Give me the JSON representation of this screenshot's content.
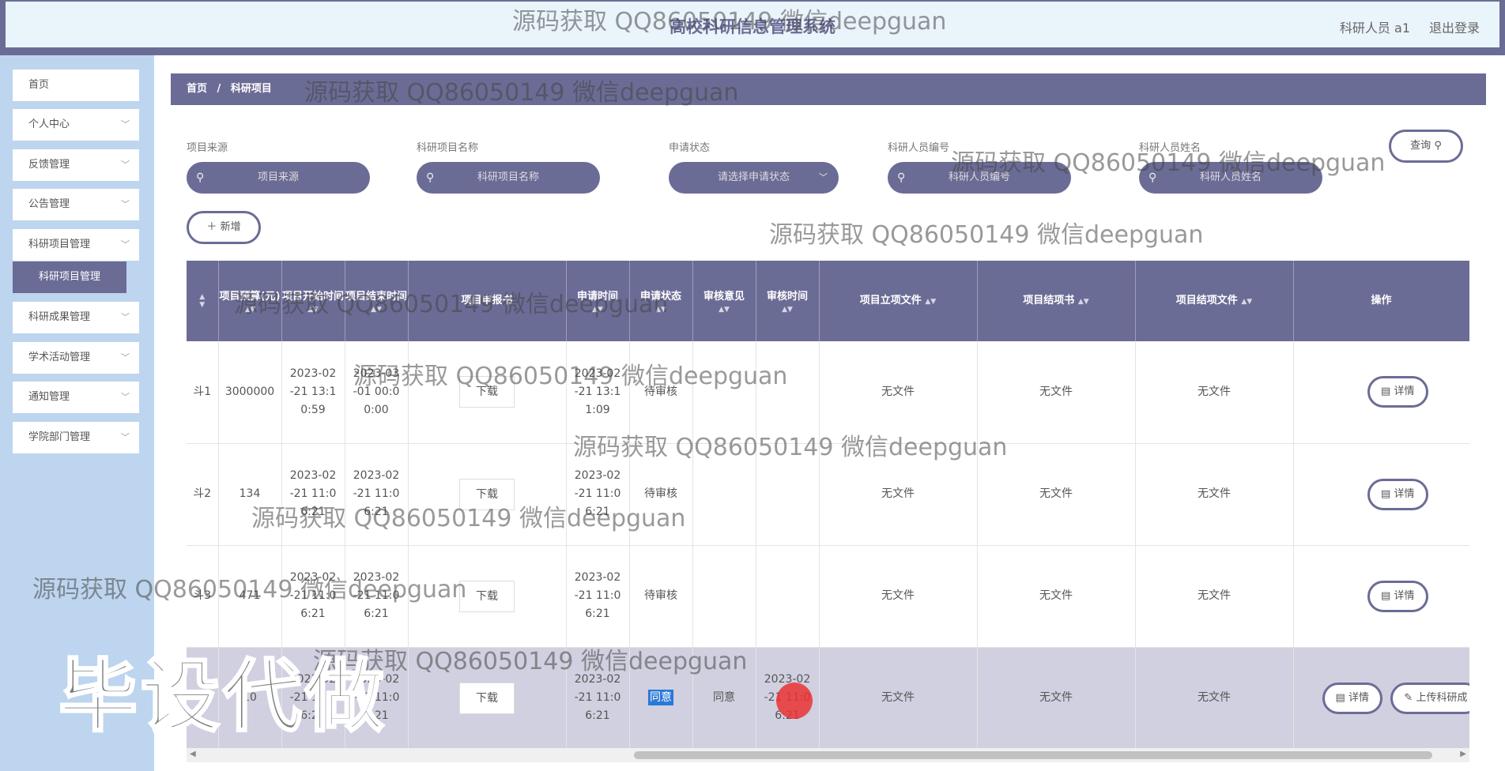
{
  "header": {
    "title": "高校科研信息管理系统",
    "user": "科研人员 a1",
    "logout": "退出登录"
  },
  "sidebar": {
    "items": [
      {
        "label": "首页",
        "has_chevron": false
      },
      {
        "label": "个人中心",
        "has_chevron": true
      },
      {
        "label": "反馈管理",
        "has_chevron": true
      },
      {
        "label": "公告管理",
        "has_chevron": true
      },
      {
        "label": "科研项目管理",
        "has_chevron": true
      },
      {
        "label": "科研成果管理",
        "has_chevron": true
      },
      {
        "label": "学术活动管理",
        "has_chevron": true
      },
      {
        "label": "通知管理",
        "has_chevron": true
      },
      {
        "label": "学院部门管理",
        "has_chevron": true
      }
    ],
    "active_sub": "科研项目管理"
  },
  "breadcrumb": {
    "home": "首页",
    "sep": "/",
    "current": "科研项目"
  },
  "filters": {
    "source_label": "项目来源",
    "source_placeholder": "项目来源",
    "name_label": "科研项目名称",
    "name_placeholder": "科研项目名称",
    "status_label": "申请状态",
    "status_placeholder": "请选择申请状态",
    "researcher_no_label": "科研人员编号",
    "researcher_no_placeholder": "科研人员编号",
    "researcher_name_label": "科研人员姓名",
    "researcher_name_placeholder": "科研人员姓名",
    "search_button": "查询"
  },
  "add_button": "新增",
  "table": {
    "headers": {
      "budget": "项目预算(元)",
      "start": "项目开始时间",
      "end": "项目结束时间",
      "apply_form": "项目申报书",
      "apply_time": "申请时间",
      "apply_status": "申请状态",
      "review_opinion": "审核意见",
      "review_time": "审核时间",
      "setup_file": "项目立项文件",
      "conclusion": "项目结项书",
      "conclusion_file": "项目结项文件",
      "ops": "操作"
    },
    "rows": [
      {
        "name_tail": "斗1",
        "budget": "3000000",
        "start": "2023-02-21 13:10:59",
        "end": "2023-03-01 00:00:00",
        "download": "下载",
        "apply_time": "2023-02-21 13:11:09",
        "status": "待审核",
        "opinion": "",
        "review_time": "",
        "setup_file": "无文件",
        "conclusion": "无文件",
        "conclusion_file": "无文件",
        "detail": "详情",
        "upload": ""
      },
      {
        "name_tail": "斗2",
        "budget": "134",
        "start": "2023-02-21 11:06:21",
        "end": "2023-02-21 11:06:21",
        "download": "下载",
        "apply_time": "2023-02-21 11:06:21",
        "status": "待审核",
        "opinion": "",
        "review_time": "",
        "setup_file": "无文件",
        "conclusion": "无文件",
        "conclusion_file": "无文件",
        "detail": "详情",
        "upload": ""
      },
      {
        "name_tail": "斗3",
        "budget": "471",
        "start": "2023-02-21 11:06:21",
        "end": "2023-02-21 11:06:21",
        "download": "下载",
        "apply_time": "2023-02-21 11:06:21",
        "status": "待审核",
        "opinion": "",
        "review_time": "",
        "setup_file": "无文件",
        "conclusion": "无文件",
        "conclusion_file": "无文件",
        "detail": "详情",
        "upload": ""
      },
      {
        "name_tail": "",
        "budget": "10",
        "start": "2023-02-21 11:06:21",
        "end": "2023-02-21 11:06:21",
        "download": "下载",
        "apply_time": "2023-02-21 11:06:21",
        "status": "同意",
        "opinion": "同意",
        "review_time": "2023-02-21 11:06:21",
        "setup_file": "无文件",
        "conclusion": "无文件",
        "conclusion_file": "无文件",
        "detail": "详情",
        "upload": "上传科研成"
      }
    ]
  },
  "watermarks": {
    "text": "源码获取 QQ86050149 微信deepguan",
    "big": "毕设代做"
  },
  "icons": [
    "search-icon",
    "chevron-down-icon",
    "plus-icon",
    "detail-icon",
    "edit-icon",
    "sort-icon"
  ],
  "colors": {
    "accent": "#6b6c96",
    "sidebar": "#bdd5ee",
    "header_bg": "#eaf4fb",
    "badge": "#2a78d8",
    "row_highlight": "#d0d0e0"
  }
}
